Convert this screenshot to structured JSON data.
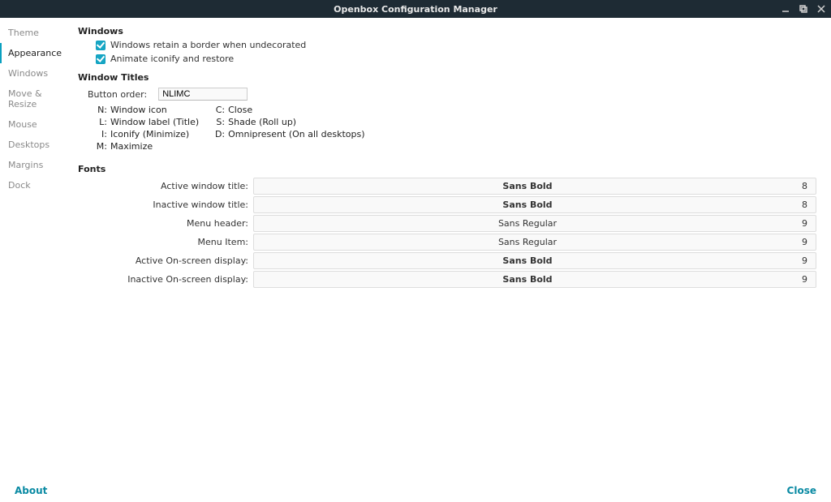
{
  "window": {
    "title": "Openbox Configuration Manager"
  },
  "sidebar": {
    "items": [
      {
        "label": "Theme"
      },
      {
        "label": "Appearance"
      },
      {
        "label": "Windows"
      },
      {
        "label": "Move & Resize"
      },
      {
        "label": "Mouse"
      },
      {
        "label": "Desktops"
      },
      {
        "label": "Margins"
      },
      {
        "label": "Dock"
      }
    ],
    "active_index": 1
  },
  "sections": {
    "windows": {
      "heading": "Windows",
      "retain_border_label": "Windows retain a border when undecorated",
      "animate_label": "Animate iconify and restore"
    },
    "window_titles": {
      "heading": "Window Titles",
      "button_order_label": "Button order:",
      "button_order_value": "NLIMC",
      "legend_col1": [
        {
          "k": "N:",
          "v": "Window icon"
        },
        {
          "k": "L:",
          "v": "Window label (Title)"
        },
        {
          "k": "I:",
          "v": "Iconify (Minimize)"
        },
        {
          "k": "M:",
          "v": "Maximize"
        }
      ],
      "legend_col2": [
        {
          "k": "C:",
          "v": "Close"
        },
        {
          "k": "S:",
          "v": "Shade (Roll up)"
        },
        {
          "k": "D:",
          "v": "Omnipresent (On all desktops)"
        }
      ]
    },
    "fonts": {
      "heading": "Fonts",
      "rows": [
        {
          "label": "Active window title:",
          "font": "Sans Bold",
          "size": "8",
          "bold": true
        },
        {
          "label": "Inactive window title:",
          "font": "Sans Bold",
          "size": "8",
          "bold": true
        },
        {
          "label": "Menu header:",
          "font": "Sans Regular",
          "size": "9",
          "bold": false
        },
        {
          "label": "Menu Item:",
          "font": "Sans Regular",
          "size": "9",
          "bold": false
        },
        {
          "label": "Active On-screen display:",
          "font": "Sans Bold",
          "size": "9",
          "bold": true
        },
        {
          "label": "Inactive On-screen display:",
          "font": "Sans Bold",
          "size": "9",
          "bold": true
        }
      ]
    }
  },
  "footer": {
    "about": "About",
    "close": "Close"
  }
}
